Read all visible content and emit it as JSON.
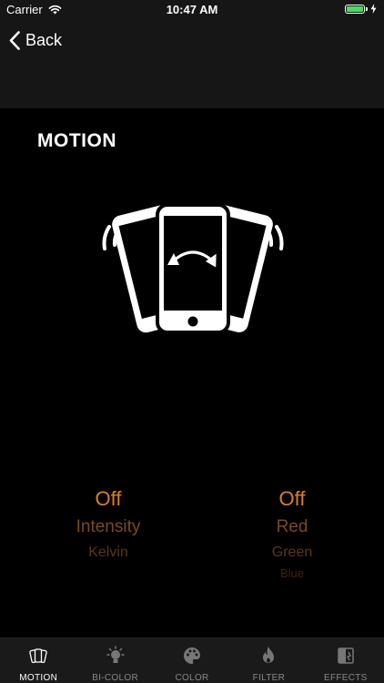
{
  "status_bar": {
    "carrier": "Carrier",
    "time": "10:47 AM",
    "battery_level": 1.0,
    "battery_color": "#4cd964"
  },
  "nav": {
    "back_label": "Back"
  },
  "page": {
    "title": "MOTION"
  },
  "pickers": {
    "left": {
      "options": [
        "Off",
        "Intensity",
        "Kelvin"
      ],
      "selected": "Off"
    },
    "right": {
      "options": [
        "Off",
        "Red",
        "Green",
        "Blue"
      ],
      "selected": "Off"
    },
    "accent_color": "#d97f2a"
  },
  "tabs": [
    {
      "label": "MOTION",
      "icon": "motion-phones-icon",
      "active": true
    },
    {
      "label": "BI-COLOR",
      "icon": "bulb-icon",
      "active": false
    },
    {
      "label": "COLOR",
      "icon": "palette-icon",
      "active": false
    },
    {
      "label": "FILTER",
      "icon": "flame-icon",
      "active": false
    },
    {
      "label": "EFFECTS",
      "icon": "effects-icon",
      "active": false
    }
  ]
}
